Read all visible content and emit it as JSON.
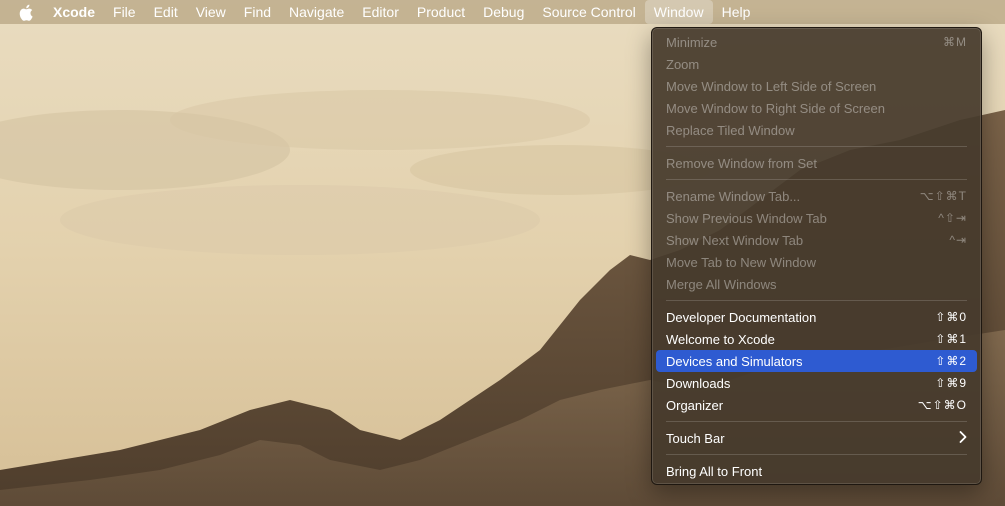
{
  "menubar": {
    "app_name": "Xcode",
    "items": [
      "File",
      "Edit",
      "View",
      "Find",
      "Navigate",
      "Editor",
      "Product",
      "Debug",
      "Source Control",
      "Window",
      "Help"
    ],
    "active_item": "Window"
  },
  "window_menu": {
    "groups": [
      [
        {
          "label": "Minimize",
          "shortcut": "⌘M",
          "enabled": false
        },
        {
          "label": "Zoom",
          "shortcut": "",
          "enabled": false
        },
        {
          "label": "Move Window to Left Side of Screen",
          "shortcut": "",
          "enabled": false
        },
        {
          "label": "Move Window to Right Side of Screen",
          "shortcut": "",
          "enabled": false
        },
        {
          "label": "Replace Tiled Window",
          "shortcut": "",
          "enabled": false
        }
      ],
      [
        {
          "label": "Remove Window from Set",
          "shortcut": "",
          "enabled": false
        }
      ],
      [
        {
          "label": "Rename Window Tab...",
          "shortcut": "⌥⇧⌘T",
          "enabled": false
        },
        {
          "label": "Show Previous Window Tab",
          "shortcut": "^⇧⇥",
          "enabled": false
        },
        {
          "label": "Show Next Window Tab",
          "shortcut": "^⇥",
          "enabled": false
        },
        {
          "label": "Move Tab to New Window",
          "shortcut": "",
          "enabled": false
        },
        {
          "label": "Merge All Windows",
          "shortcut": "",
          "enabled": false
        }
      ],
      [
        {
          "label": "Developer Documentation",
          "shortcut": "⇧⌘0",
          "enabled": true
        },
        {
          "label": "Welcome to Xcode",
          "shortcut": "⇧⌘1",
          "enabled": true
        },
        {
          "label": "Devices and Simulators",
          "shortcut": "⇧⌘2",
          "enabled": true,
          "highlighted": true
        },
        {
          "label": "Downloads",
          "shortcut": "⇧⌘9",
          "enabled": true
        },
        {
          "label": "Organizer",
          "shortcut": "⌥⇧⌘O",
          "enabled": true
        }
      ],
      [
        {
          "label": "Touch Bar",
          "shortcut": "",
          "enabled": true,
          "submenu": true
        }
      ],
      [
        {
          "label": "Bring All to Front",
          "shortcut": "",
          "enabled": true
        }
      ]
    ]
  },
  "icons": {
    "apple": "apple-logo-icon",
    "submenu": "chevron-right-icon"
  },
  "colors": {
    "highlight": "#2e5bd1",
    "menu_background": "#463a2c"
  }
}
